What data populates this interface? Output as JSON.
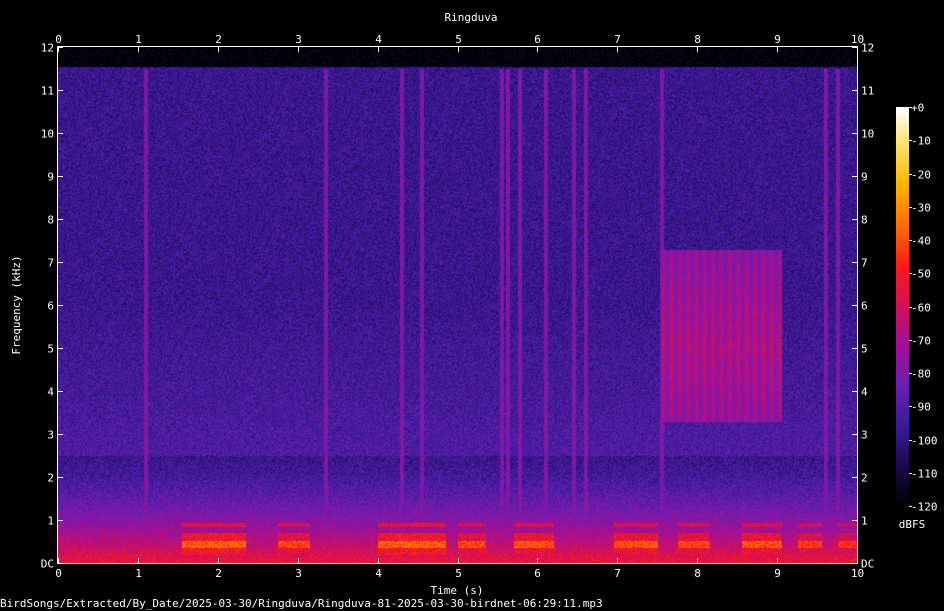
{
  "chart_data": {
    "type": "heatmap",
    "title": "Ringduva",
    "xlabel": "Time (s)",
    "ylabel": "Frequency (kHz)",
    "xlim": [
      0,
      10
    ],
    "ylim": [
      0,
      12
    ],
    "x_ticks": [
      {
        "value": 0,
        "label": "0"
      },
      {
        "value": 1,
        "label": "1"
      },
      {
        "value": 2,
        "label": "2"
      },
      {
        "value": 3,
        "label": "3"
      },
      {
        "value": 4,
        "label": "4"
      },
      {
        "value": 5,
        "label": "5"
      },
      {
        "value": 6,
        "label": "6"
      },
      {
        "value": 7,
        "label": "7"
      },
      {
        "value": 8,
        "label": "8"
      },
      {
        "value": 9,
        "label": "9"
      },
      {
        "value": 10,
        "label": "10"
      }
    ],
    "y_ticks": [
      {
        "value": 0,
        "label": "DC"
      },
      {
        "value": 1,
        "label": "1"
      },
      {
        "value": 2,
        "label": "2"
      },
      {
        "value": 3,
        "label": "3"
      },
      {
        "value": 4,
        "label": "4"
      },
      {
        "value": 5,
        "label": "5"
      },
      {
        "value": 6,
        "label": "6"
      },
      {
        "value": 7,
        "label": "7"
      },
      {
        "value": 8,
        "label": "8"
      },
      {
        "value": 9,
        "label": "9"
      },
      {
        "value": 10,
        "label": "10"
      },
      {
        "value": 11,
        "label": "11"
      },
      {
        "value": 12,
        "label": "12"
      }
    ],
    "colorbar": {
      "label": "dBFS",
      "range": [
        -120,
        0
      ],
      "ticks": [
        {
          "value": 0,
          "label": "+0"
        },
        {
          "value": -10,
          "label": "-10"
        },
        {
          "value": -20,
          "label": "-20"
        },
        {
          "value": -30,
          "label": "-30"
        },
        {
          "value": -40,
          "label": "-40"
        },
        {
          "value": -50,
          "label": "-50"
        },
        {
          "value": -60,
          "label": "-60"
        },
        {
          "value": -70,
          "label": "-70"
        },
        {
          "value": -80,
          "label": "-80"
        },
        {
          "value": -90,
          "label": "-90"
        },
        {
          "value": -100,
          "label": "-100"
        },
        {
          "value": -110,
          "label": "-110"
        },
        {
          "value": -120,
          "label": "-120"
        }
      ],
      "colors": [
        "#000000",
        "#1a0a4a",
        "#3b1a9a",
        "#6a1fb0",
        "#a0109a",
        "#d0105a",
        "#ff1a1a",
        "#ff6a00",
        "#ffb000",
        "#ffe060",
        "#ffffff"
      ]
    },
    "noise_floor_db": -97,
    "low_freq_band": {
      "max_khz": 2.5,
      "peak_db": -52
    },
    "coo_events": [
      {
        "t_start": 1.55,
        "t_end": 2.35,
        "freq_khz": 0.45,
        "level_db": -38
      },
      {
        "t_start": 2.75,
        "t_end": 3.15,
        "freq_khz": 0.45,
        "level_db": -42
      },
      {
        "t_start": 4.0,
        "t_end": 4.85,
        "freq_khz": 0.45,
        "level_db": -38
      },
      {
        "t_start": 5.0,
        "t_end": 5.35,
        "freq_khz": 0.45,
        "level_db": -42
      },
      {
        "t_start": 5.7,
        "t_end": 6.2,
        "freq_khz": 0.45,
        "level_db": -40
      },
      {
        "t_start": 6.95,
        "t_end": 7.5,
        "freq_khz": 0.45,
        "level_db": -40
      },
      {
        "t_start": 7.75,
        "t_end": 8.15,
        "freq_khz": 0.45,
        "level_db": -42
      },
      {
        "t_start": 8.55,
        "t_end": 9.05,
        "freq_khz": 0.45,
        "level_db": -40
      },
      {
        "t_start": 9.25,
        "t_end": 9.55,
        "freq_khz": 0.45,
        "level_db": -44
      },
      {
        "t_start": 9.75,
        "t_end": 10.0,
        "freq_khz": 0.45,
        "level_db": -46
      }
    ],
    "broadband_region": {
      "t_start": 7.55,
      "t_end": 9.05,
      "freq_low_khz": 3.3,
      "freq_high_khz": 7.3,
      "level_db": -68
    },
    "transients_s": [
      1.1,
      3.35,
      4.3,
      4.55,
      5.55,
      5.62,
      5.78,
      6.1,
      6.45,
      6.6,
      7.55,
      9.6,
      9.75
    ]
  },
  "footer": {
    "filename": "BirdSongs/Extracted/By_Date/2025-03-30/Ringduva/Ringduva-81-2025-03-30-birdnet-06:29:11.mp3"
  }
}
